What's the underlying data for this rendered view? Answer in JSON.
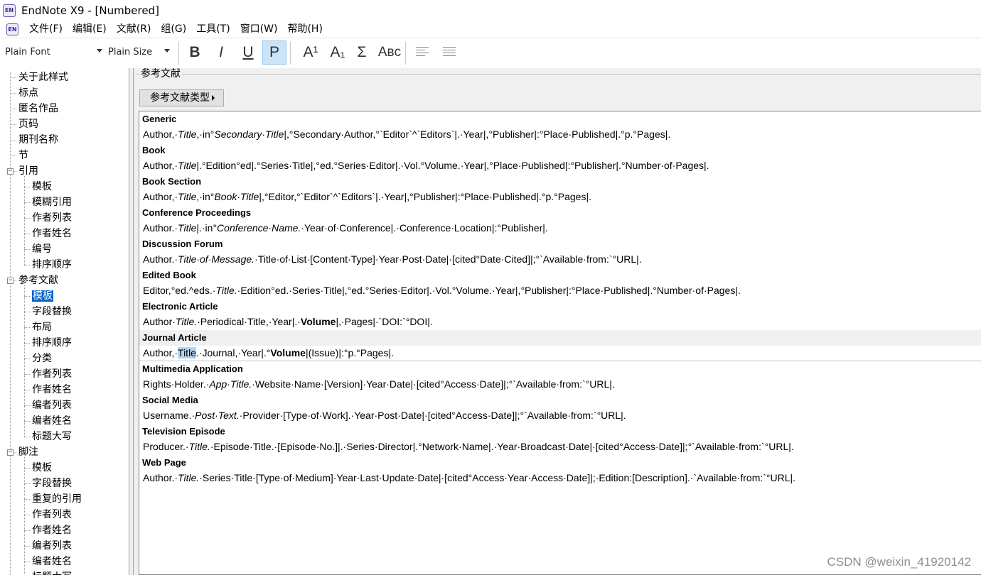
{
  "window": {
    "title": "EndNote X9 - [Numbered]",
    "icon": "endnote-app-icon",
    "icon_text": "EN"
  },
  "menu": [
    "文件(F)",
    "编辑(E)",
    "文献(R)",
    "组(G)",
    "工具(T)",
    "窗口(W)",
    "帮助(H)"
  ],
  "toolbar": {
    "font": "Plain Font",
    "size": "Plain Size",
    "bold": "B",
    "italic": "I",
    "underline": "U",
    "plain": "P",
    "superscript": "A¹",
    "subscript": "A₁",
    "symbol": "Σ",
    "smallcaps": "Aʙᴄ",
    "active_button": "plain",
    "icons": [
      "align-left-icon",
      "justify-icon"
    ]
  },
  "sidebar": {
    "items": [
      {
        "label": "关于此样式"
      },
      {
        "label": "标点"
      },
      {
        "label": "匿名作品"
      },
      {
        "label": "页码"
      },
      {
        "label": "期刊名称"
      },
      {
        "label": "节"
      },
      {
        "label": "引用",
        "expander": "−"
      },
      {
        "label": "模板"
      },
      {
        "label": "模糊引用"
      },
      {
        "label": "作者列表"
      },
      {
        "label": "作者姓名"
      },
      {
        "label": "编号"
      },
      {
        "label": "排序顺序"
      },
      {
        "label": "参考文献",
        "expander": "−"
      },
      {
        "label": "模板",
        "selected": true
      },
      {
        "label": "字段替换"
      },
      {
        "label": "布局"
      },
      {
        "label": "排序顺序"
      },
      {
        "label": "分类"
      },
      {
        "label": "作者列表"
      },
      {
        "label": "作者姓名"
      },
      {
        "label": "编者列表"
      },
      {
        "label": "编者姓名"
      },
      {
        "label": "标题大写"
      },
      {
        "label": "脚注",
        "expander": "−"
      },
      {
        "label": "模板"
      },
      {
        "label": "字段替换"
      },
      {
        "label": "重复的引用"
      },
      {
        "label": "作者列表"
      },
      {
        "label": "作者姓名"
      },
      {
        "label": "编者列表"
      },
      {
        "label": "编者姓名"
      },
      {
        "label": "标题大写"
      }
    ]
  },
  "panel": {
    "group_label": "参考文献",
    "type_button": "参考文献类型"
  },
  "references": [
    {
      "type": "Generic",
      "segments": [
        {
          "t": "Author,·"
        },
        {
          "t": "Title",
          "i": true
        },
        {
          "t": ",·in°"
        },
        {
          "t": "Secondary·Title",
          "i": true
        },
        {
          "t": "|,°Secondary·Author,°`Editor`^`Editors`|.·Year|,°Publisher|:°Place·Published|.°p.°Pages|."
        }
      ]
    },
    {
      "type": "Book",
      "segments": [
        {
          "t": "Author,·"
        },
        {
          "t": "Title",
          "i": true
        },
        {
          "t": "|.°Edition°ed|.°Series·Title|,°ed.°Series·Editor|.·Vol.°Volume.·Year|,°Place·Published|:°Publisher|.°Number·of·Pages|."
        }
      ]
    },
    {
      "type": "Book Section",
      "segments": [
        {
          "t": "Author,·"
        },
        {
          "t": "Title",
          "i": true
        },
        {
          "t": ",·in°"
        },
        {
          "t": "Book·Title",
          "i": true
        },
        {
          "t": "|,°Editor,°`Editor`^`Editors`|.·Year|,°Publisher|:°Place·Published|.°p.°Pages|."
        }
      ]
    },
    {
      "type": "Conference Proceedings",
      "segments": [
        {
          "t": "Author.·"
        },
        {
          "t": "Title",
          "i": true
        },
        {
          "t": "|.·in°"
        },
        {
          "t": "Conference·Name.",
          "i": true
        },
        {
          "t": "·Year·of·Conference|.·Conference·Location|:°Publisher|."
        }
      ]
    },
    {
      "type": "Discussion Forum",
      "segments": [
        {
          "t": "Author.·"
        },
        {
          "t": "Title·of·Message.",
          "i": true
        },
        {
          "t": "·Title·of·List·[Content·Type]·Year·Post·Date|·[cited°Date·Cited]|;°`Available·from:`°URL|."
        }
      ]
    },
    {
      "type": "Edited Book",
      "segments": [
        {
          "t": "Editor,°ed.^eds.·"
        },
        {
          "t": "Title.",
          "i": true
        },
        {
          "t": "·Edition°ed.·Series·Title|,°ed.°Series·Editor|.·Vol.°Volume.·Year|,°Publisher|:°Place·Published|.°Number·of·Pages|."
        }
      ]
    },
    {
      "type": "Electronic Article",
      "segments": [
        {
          "t": "Author·"
        },
        {
          "t": "Title.",
          "i": true
        },
        {
          "t": "·Periodical·Title,·Year|.·"
        },
        {
          "t": "Volume",
          "b": true
        },
        {
          "t": "|,·Pages|·`DOI:`°DOI|."
        }
      ]
    },
    {
      "type": "Journal Article",
      "highlight": true,
      "segments": [
        {
          "t": "Author,·"
        },
        {
          "t": "Title",
          "hl": true
        },
        {
          "t": ".·Journal,·Year|.°"
        },
        {
          "t": "Volume",
          "b": true
        },
        {
          "t": "|(Issue)|:°p.°Pages|."
        }
      ]
    },
    {
      "type": "Multimedia Application",
      "segments": [
        {
          "t": "Rights·Holder.·"
        },
        {
          "t": "App·Title.",
          "i": true
        },
        {
          "t": "·Website·Name·[Version]·Year·Date|·[cited°Access·Date]|;°`Available·from:`°URL|."
        }
      ]
    },
    {
      "type": "Social Media",
      "segments": [
        {
          "t": "Username.·"
        },
        {
          "t": "Post·Text.",
          "i": true
        },
        {
          "t": "·Provider·[Type·of·Work].·Year·Post·Date|·[cited°Access·Date]|;°`Available·from:`°URL|."
        }
      ]
    },
    {
      "type": "Television Episode",
      "segments": [
        {
          "t": "Producer.·"
        },
        {
          "t": "Title.",
          "i": true
        },
        {
          "t": "·Episode·Title.·[Episode·No.]|.·Series·Director|.°Network·Name|.·Year·Broadcast·Date|·[cited°Access·Date]|;°`Available·from:`°URL|."
        }
      ]
    },
    {
      "type": "Web Page",
      "segments": [
        {
          "t": "Author.·"
        },
        {
          "t": "Title.",
          "i": true
        },
        {
          "t": "·Series·Title·[Type·of·Medium]·Year·Last·Update·Date|·[cited°Access·Year·Access·Date]|;·Edition:[Description].·`Available·from:`°URL|."
        }
      ]
    }
  ],
  "watermark": "CSDN @weixin_41920142"
}
